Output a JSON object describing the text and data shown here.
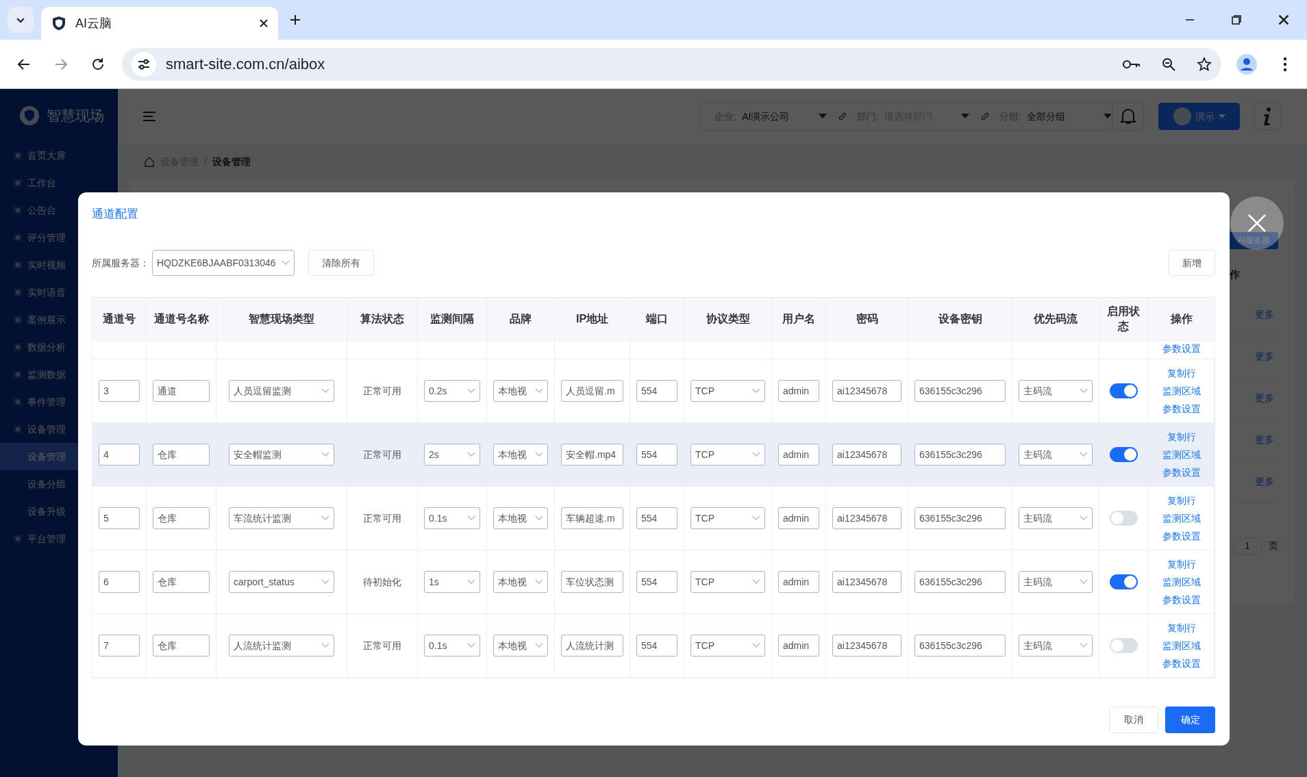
{
  "browser": {
    "tab_title": "AI云脑",
    "url": "smart-site.com.cn/aibox"
  },
  "sidebar": {
    "logo": "智慧现场",
    "items": [
      {
        "label": "首页大屏"
      },
      {
        "label": "工作台"
      },
      {
        "label": "公告台"
      },
      {
        "label": "评分管理"
      },
      {
        "label": "实时视频"
      },
      {
        "label": "实时语音"
      },
      {
        "label": "案例展示"
      },
      {
        "label": "数据分析"
      },
      {
        "label": "监测数据"
      },
      {
        "label": "事件管理"
      },
      {
        "label": "设备管理",
        "expanded": true,
        "children": [
          {
            "label": "设备管理",
            "selected": true
          },
          {
            "label": "设备分组",
            "selected": false
          },
          {
            "label": "设备升级",
            "selected": false
          }
        ]
      },
      {
        "label": "平台管理"
      }
    ]
  },
  "header": {
    "filters": [
      {
        "label": "企业:",
        "value": "AI演示公司"
      },
      {
        "label": "部门:",
        "placeholder": "请选择部门"
      },
      {
        "label": "分组:",
        "value": "全部分组"
      }
    ],
    "user": "演示"
  },
  "breadcrumb": {
    "items": [
      "设备管理",
      "设备管理"
    ],
    "separator": "/"
  },
  "background_page": {
    "button": "AI服务器",
    "column_header": "作",
    "row_links": [
      "更多",
      "更多",
      "更多",
      "更多",
      "更多"
    ],
    "page_input": "1",
    "page_suffix": "页"
  },
  "modal": {
    "title": "通道配置",
    "server_label": "所属服务器：",
    "server_value": "HQDZKE6BJAABF0313046",
    "clear_button": "清除所有",
    "add_button": "新增",
    "columns": [
      {
        "label": "通道号",
        "kind": "input"
      },
      {
        "label": "通道号名称",
        "kind": "input"
      },
      {
        "label": "智慧现场类型",
        "kind": "select"
      },
      {
        "label": "算法状态",
        "kind": "text"
      },
      {
        "label": "监测间隔",
        "kind": "select"
      },
      {
        "label": "品牌",
        "kind": "select"
      },
      {
        "label": "IP地址",
        "kind": "input"
      },
      {
        "label": "端口",
        "kind": "input"
      },
      {
        "label": "协议类型",
        "kind": "select"
      },
      {
        "label": "用户名",
        "kind": "input"
      },
      {
        "label": "密码",
        "kind": "input"
      },
      {
        "label": "设备密钥",
        "kind": "input"
      },
      {
        "label": "优先码流",
        "kind": "select"
      },
      {
        "label": "启用状态",
        "kind": "toggle"
      },
      {
        "label": "操作",
        "kind": "actions"
      }
    ],
    "partial_row": {
      "actions": [
        "参数设置"
      ]
    },
    "rows": [
      {
        "channel": "3",
        "name": "通道",
        "type": "人员逗留监测",
        "algo_status": "正常可用",
        "interval": "0.2s",
        "brand": "本地视",
        "ip": "人员逗留.m",
        "port": "554",
        "protocol": "TCP",
        "username": "admin",
        "password": "ai12345678",
        "device_key": "636155c3c296",
        "stream": "主码流",
        "enabled": true,
        "highlighted": false,
        "actions": [
          "复制行",
          "监测区域",
          "参数设置"
        ]
      },
      {
        "channel": "4",
        "name": "仓库",
        "type": "安全帽监测",
        "algo_status": "正常可用",
        "interval": "2s",
        "brand": "本地视",
        "ip": "安全帽.mp4",
        "port": "554",
        "protocol": "TCP",
        "username": "admin",
        "password": "ai12345678",
        "device_key": "636155c3c296",
        "stream": "主码流",
        "enabled": true,
        "highlighted": true,
        "actions": [
          "复制行",
          "监测区域",
          "参数设置"
        ]
      },
      {
        "channel": "5",
        "name": "仓库",
        "type": "车流统计监测",
        "algo_status": "正常可用",
        "interval": "0.1s",
        "brand": "本地视",
        "ip": "车辆超速.m",
        "port": "554",
        "protocol": "TCP",
        "username": "admin",
        "password": "ai12345678",
        "device_key": "636155c3c296",
        "stream": "主码流",
        "enabled": false,
        "highlighted": false,
        "actions": [
          "复制行",
          "监测区域",
          "参数设置"
        ]
      },
      {
        "channel": "6",
        "name": "仓库",
        "type": "carport_status",
        "algo_status": "待初始化",
        "interval": "1s",
        "brand": "本地视",
        "ip": "车位状态测",
        "port": "554",
        "protocol": "TCP",
        "username": "admin",
        "password": "ai12345678",
        "device_key": "636155c3c296",
        "stream": "主码流",
        "enabled": true,
        "highlighted": false,
        "actions": [
          "复制行",
          "监测区域",
          "参数设置"
        ]
      },
      {
        "channel": "7",
        "name": "仓库",
        "type": "人流统计监测",
        "algo_status": "正常可用",
        "interval": "0.1s",
        "brand": "本地视",
        "ip": "人流统计测",
        "port": "554",
        "protocol": "TCP",
        "username": "admin",
        "password": "ai12345678",
        "device_key": "636155c3c296",
        "stream": "主码流",
        "enabled": false,
        "highlighted": false,
        "actions": [
          "复制行",
          "监测区域",
          "参数设置"
        ]
      }
    ],
    "cancel_button": "取消",
    "confirm_button": "确定"
  }
}
